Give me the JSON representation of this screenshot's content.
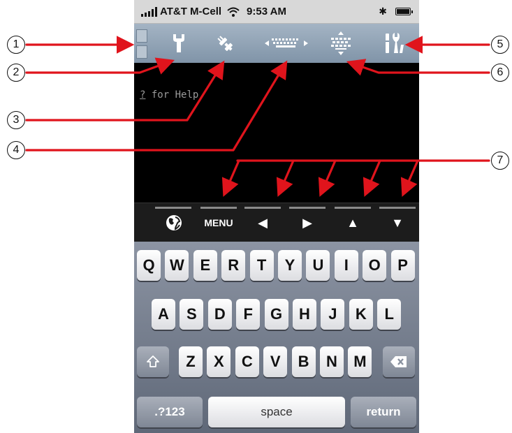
{
  "status_bar": {
    "carrier": "AT&T M-Cell",
    "time": "9:53 AM",
    "bluetooth_icon": "bluetooth-icon",
    "battery_level": 1.0
  },
  "toolbar": {
    "icons": [
      "drawer-toggle-icon",
      "wrench-icon",
      "plug-icon",
      "keyboard-icon",
      "keyboard-resize-icon",
      "tools-icon"
    ]
  },
  "terminal": {
    "help_key": "?",
    "help_text": " for Help"
  },
  "accessory_bar": {
    "globe_icon": "globe-icon",
    "menu_label": "MENU",
    "left_glyph": "◀",
    "right_glyph": "▶",
    "up_glyph": "▲",
    "down_glyph": "▼"
  },
  "keyboard": {
    "row1": [
      "Q",
      "W",
      "E",
      "R",
      "T",
      "Y",
      "U",
      "I",
      "O",
      "P"
    ],
    "row2": [
      "A",
      "S",
      "D",
      "F",
      "G",
      "H",
      "J",
      "K",
      "L"
    ],
    "row3": [
      "Z",
      "X",
      "C",
      "V",
      "B",
      "N",
      "M"
    ],
    "shift_icon": "shift-icon",
    "delete_icon": "delete-icon",
    "numbers_label": ".?123",
    "space_label": "space",
    "return_label": "return"
  },
  "callouts": [
    "1",
    "2",
    "3",
    "4",
    "5",
    "6",
    "7"
  ],
  "colors": {
    "arrow": "#e0141c",
    "toolbar": "#90a2b5",
    "terminal_bg": "#000000"
  }
}
